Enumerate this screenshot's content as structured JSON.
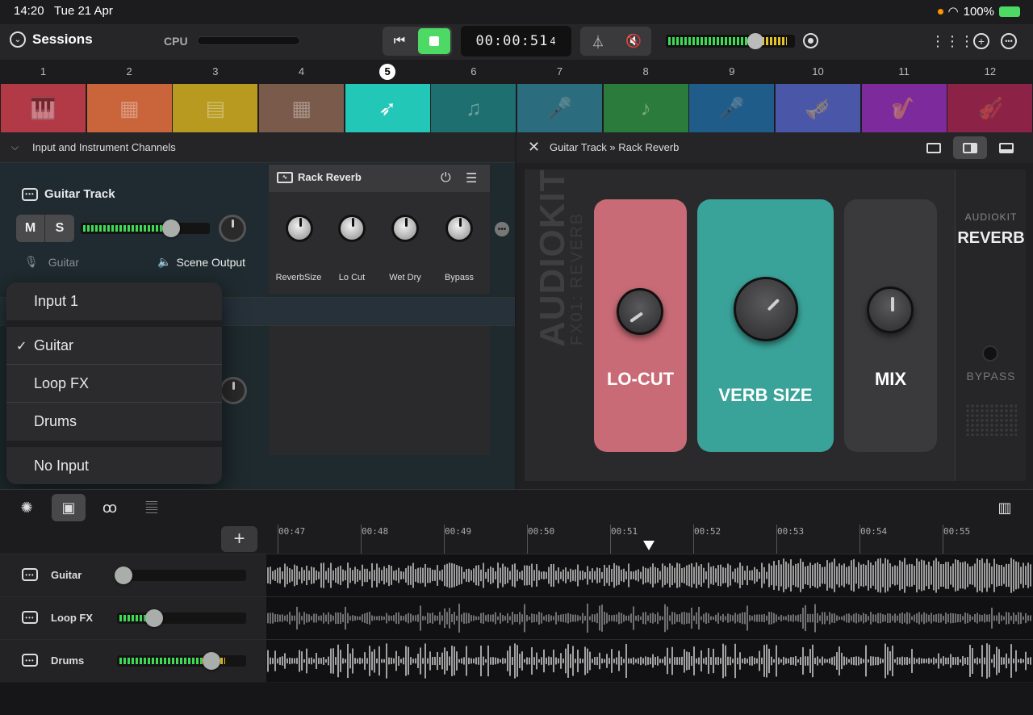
{
  "status": {
    "time": "14:20",
    "date": "Tue 21 Apr",
    "battery": "100%"
  },
  "toolbar": {
    "sessions_label": "Sessions",
    "cpu_label": "CPU",
    "timecode": "00:00:51",
    "timecode_sub": "4"
  },
  "scenes": {
    "numbers": [
      "1",
      "2",
      "3",
      "4",
      "5",
      "6",
      "7",
      "8",
      "9",
      "10",
      "11",
      "12"
    ],
    "active_index": 4,
    "items": [
      {
        "icon": "piano-icon",
        "glyph": "🎹",
        "color": "#b23a46"
      },
      {
        "icon": "synth-icon",
        "glyph": "▦",
        "color": "#c9643b"
      },
      {
        "icon": "keyboard-icon",
        "glyph": "▤",
        "color": "#b79a1f"
      },
      {
        "icon": "drum-machine-icon",
        "glyph": "▦",
        "color": "#7a5a4a"
      },
      {
        "icon": "electric-guitar-icon",
        "glyph": "➶",
        "color": "#22c7b8"
      },
      {
        "icon": "guitar-icon",
        "glyph": "♫",
        "color": "#1e6f6f"
      },
      {
        "icon": "microphone-icon",
        "glyph": "🎤",
        "color": "#2b6d7e"
      },
      {
        "icon": "acoustic-guitar-icon",
        "glyph": "♪",
        "color": "#2a7b3c"
      },
      {
        "icon": "duet-mic-icon",
        "glyph": "🎤",
        "color": "#1f5c8a"
      },
      {
        "icon": "trumpet-icon",
        "glyph": "🎺",
        "color": "#4a57a8"
      },
      {
        "icon": "saxophone-icon",
        "glyph": "🎷",
        "color": "#7d2a9c"
      },
      {
        "icon": "violin-icon",
        "glyph": "🎻",
        "color": "#8c2346"
      }
    ]
  },
  "left_panel": {
    "header": "Input and Instrument Channels",
    "track_title": "Guitar Track",
    "mute_label": "M",
    "solo_label": "S",
    "input_label": "Guitar",
    "output_label": "Scene Output",
    "meter_level": 0.7
  },
  "rack": {
    "title": "Rack Reverb",
    "knobs": [
      "ReverbSize",
      "Lo Cut",
      "Wet Dry",
      "Bypass"
    ]
  },
  "dropdown": {
    "items": [
      "Input 1",
      "Guitar",
      "Loop FX",
      "Drums",
      "No Input"
    ],
    "selected": "Guitar"
  },
  "plugin": {
    "path": "Guitar Track » Rack Reverb",
    "brand": "AUDIOKIT",
    "brand_sub": "FX01: REVERB",
    "panels": [
      {
        "label": "LO-CUT",
        "color": "#c96b76"
      },
      {
        "label": "VERB SIZE",
        "color": "#3aa399"
      },
      {
        "label": "MIX",
        "color": "#3a3a3c"
      }
    ],
    "side_brand_top": "AUDIOKIT",
    "side_brand_bottom": "REVERB",
    "bypass_label": "BYPASS"
  },
  "timeline": {
    "ticks": [
      "00:47",
      "00:48",
      "00:49",
      "00:50",
      "00:51",
      "00:52",
      "00:53",
      "00:54",
      "00:55"
    ],
    "tracks": [
      {
        "name": "Guitar",
        "level": 0.0
      },
      {
        "name": "Loop FX",
        "level": 0.3
      },
      {
        "name": "Drums",
        "level": 0.85
      }
    ]
  }
}
